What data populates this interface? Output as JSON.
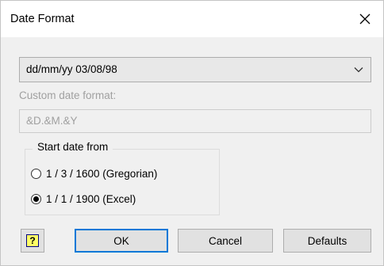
{
  "window": {
    "title": "Date Format",
    "close_icon": "close-icon"
  },
  "format_combo": {
    "selected": "dd/mm/yy 03/08/98",
    "arrow_icon": "chevron-down-icon"
  },
  "custom": {
    "label": "Custom date format:",
    "value": "&D.&M.&Y",
    "enabled": false
  },
  "start_date": {
    "legend": "Start date from",
    "options": [
      {
        "label": "1 / 3 / 1600 (Gregorian)",
        "selected": false
      },
      {
        "label": "1 / 1 / 1900 (Excel)",
        "selected": true
      }
    ]
  },
  "buttons": {
    "help_icon": "help-icon",
    "help_glyph": "?",
    "ok": "OK",
    "cancel": "Cancel",
    "defaults": "Defaults"
  },
  "colors": {
    "focus_border": "#0078d7",
    "disabled_text": "#a0a0a0"
  }
}
